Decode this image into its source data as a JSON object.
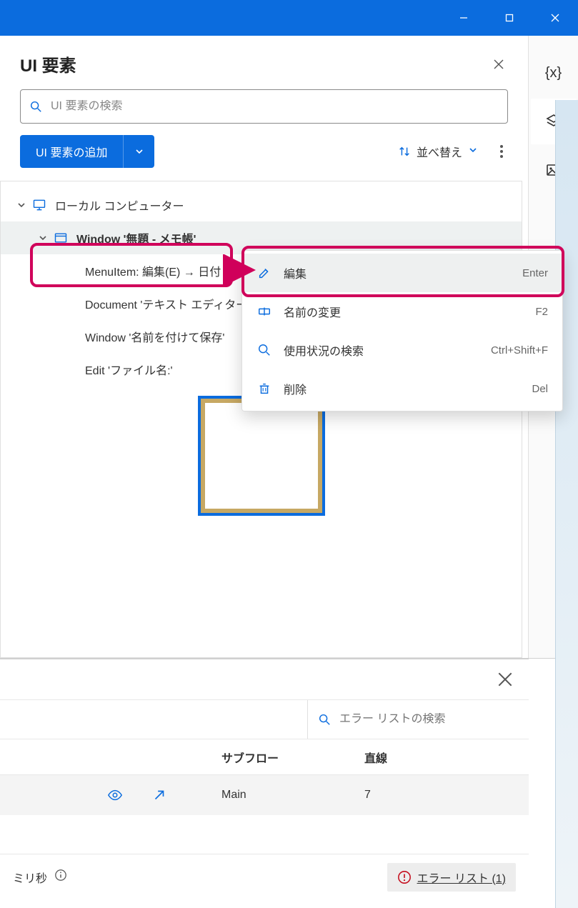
{
  "titlebar": {},
  "panel": {
    "title": "UI 要素",
    "search_placeholder": "UI 要素の検索",
    "add_button": "UI 要素の追加",
    "sort_label": "並べ替え"
  },
  "tree": {
    "root": "ローカル コンピューター",
    "window": "Window '無題 - メモ帳'",
    "children": [
      "MenuItem: 編集(E) → 日付と",
      "Document 'テキスト エディター'",
      "Window '名前を付けて保存'",
      "Edit 'ファイル名:'"
    ]
  },
  "context_menu": {
    "items": [
      {
        "label": "編集",
        "shortcut": "Enter"
      },
      {
        "label": "名前の変更",
        "shortcut": "F2"
      },
      {
        "label": "使用状況の検索",
        "shortcut": "Ctrl+Shift+F"
      },
      {
        "label": "削除",
        "shortcut": "Del"
      }
    ]
  },
  "bottom": {
    "search_placeholder": "エラー リストの検索",
    "col_subflow": "サブフロー",
    "col_line": "直線",
    "row": {
      "subflow": "Main",
      "line": "7"
    }
  },
  "status": {
    "left": "ミリ秒",
    "error_label": "エラー リスト (1)"
  },
  "sidebar": {
    "tabs": [
      "variables",
      "layers",
      "images"
    ]
  }
}
